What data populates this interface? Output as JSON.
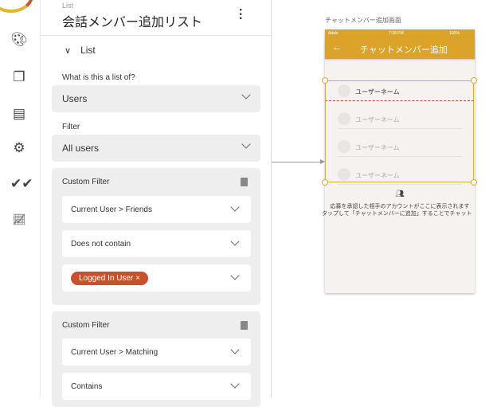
{
  "panel": {
    "label": "List",
    "title": "会話メンバー追加リスト",
    "section": "List",
    "list_of_label": "What is this a list of?",
    "list_of": "Users",
    "filter_label": "Filter",
    "filter": "All users",
    "filters": [
      {
        "title": "Custom Filter",
        "rows": [
          "Current User > Friends",
          "Does not contain"
        ],
        "chip": "Logged In User"
      },
      {
        "title": "Custom Filter",
        "rows": [
          "Current User > Matching",
          "Contains"
        ]
      }
    ]
  },
  "screen": {
    "name": "チャットメンバー追加画面",
    "carrier": "Adalo",
    "time": "7:38 PM",
    "battery": "100%",
    "title": "チャットメンバー追加",
    "items": [
      "ユーザーネーム",
      "ユーザーネーム",
      "ユーザーネーム",
      "ユーザーネーム"
    ],
    "empty_line1": "応募を承認した相手のアカウントがここに表示されます",
    "empty_line2": "タップして「チャットメンバーに追加」することでチャットを"
  },
  "colors": {
    "accent": "#dba32a",
    "chip": "#c9502c"
  }
}
